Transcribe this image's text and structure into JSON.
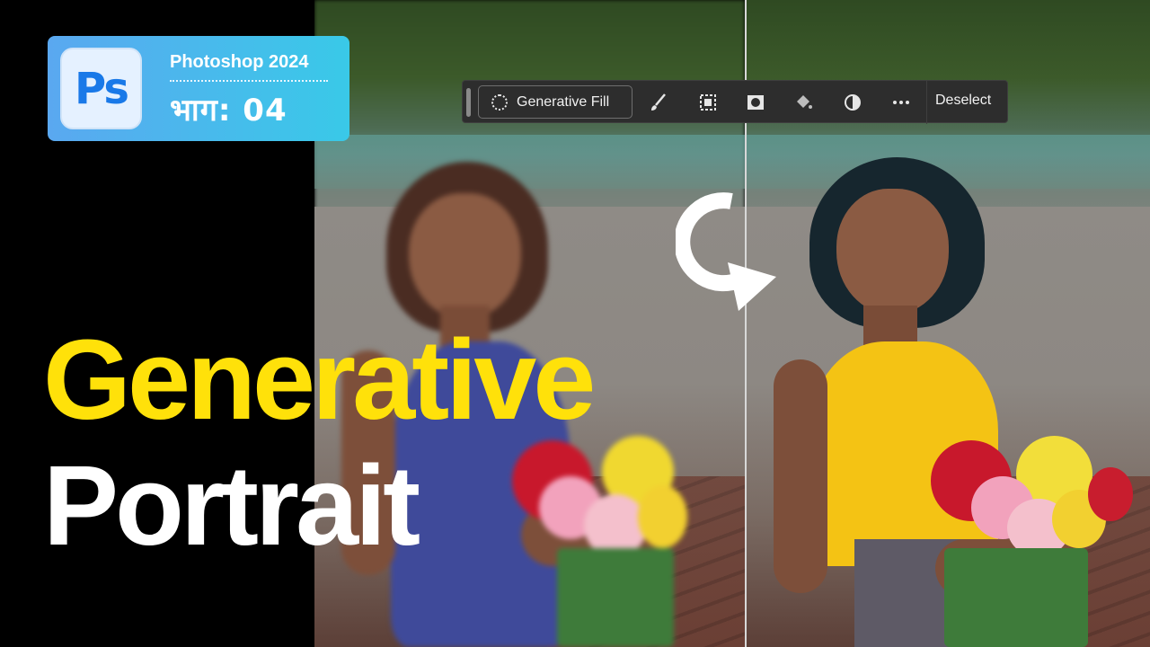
{
  "title_card": {
    "logo": "Ps",
    "line1": "Photoshop 2024",
    "line2": "भाग: 04"
  },
  "toolbar": {
    "generative_fill": "Generative Fill",
    "deselect": "Deselect",
    "icons": [
      "brush-icon",
      "selection-mask-icon",
      "layer-mask-icon",
      "fill-bucket-icon",
      "adjustment-icon",
      "more-options-icon"
    ]
  },
  "headline": {
    "line1": "Generative",
    "line2": "Portrait"
  },
  "colors": {
    "headline_yellow": "#ffe10a",
    "headline_white": "#ffffff",
    "card_gradient_start": "#5aa8f0",
    "card_gradient_end": "#39c9e8",
    "ps_blue": "#1979e8",
    "toolbar_bg": "#2d2d2d"
  }
}
